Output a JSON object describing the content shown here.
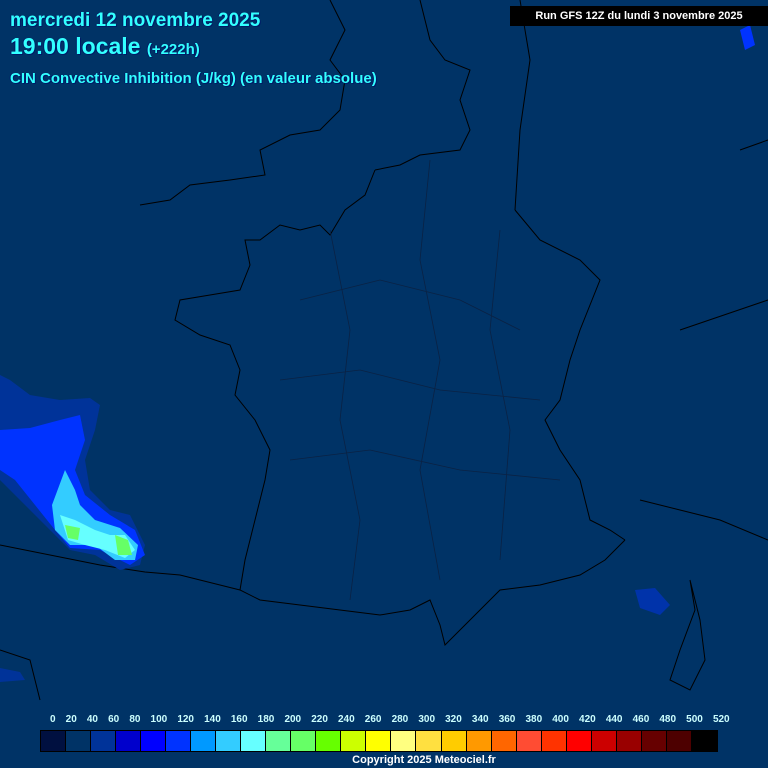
{
  "header": {
    "date": "mercredi 12 novembre 2025",
    "time": "19:00 locale",
    "offset": "(+222h)",
    "title": "CIN Convective Inhibition (J/kg) (en valeur absolue)",
    "run": "Run GFS 12Z du lundi 3 novembre 2025"
  },
  "legend": {
    "labels": [
      "0",
      "20",
      "40",
      "60",
      "80",
      "100",
      "120",
      "140",
      "160",
      "180",
      "200",
      "220",
      "240",
      "260",
      "280",
      "300",
      "320",
      "340",
      "360",
      "380",
      "400",
      "420",
      "440",
      "460",
      "480",
      "500",
      "520"
    ],
    "colors": [
      "#001040",
      "#003366",
      "#003399",
      "#0000cc",
      "#0000ff",
      "#0033ff",
      "#0099ff",
      "#33ccff",
      "#66ffff",
      "#66ff99",
      "#66ff66",
      "#66ff00",
      "#ccff00",
      "#ffff00",
      "#ffff80",
      "#ffe040",
      "#ffcc00",
      "#ff9900",
      "#ff6600",
      "#ff4c33",
      "#ff3300",
      "#ff0000",
      "#cc0000",
      "#990000",
      "#660000",
      "#4d0000",
      "#000000"
    ]
  },
  "copyright": "Copyright 2025 Meteociel.fr"
}
